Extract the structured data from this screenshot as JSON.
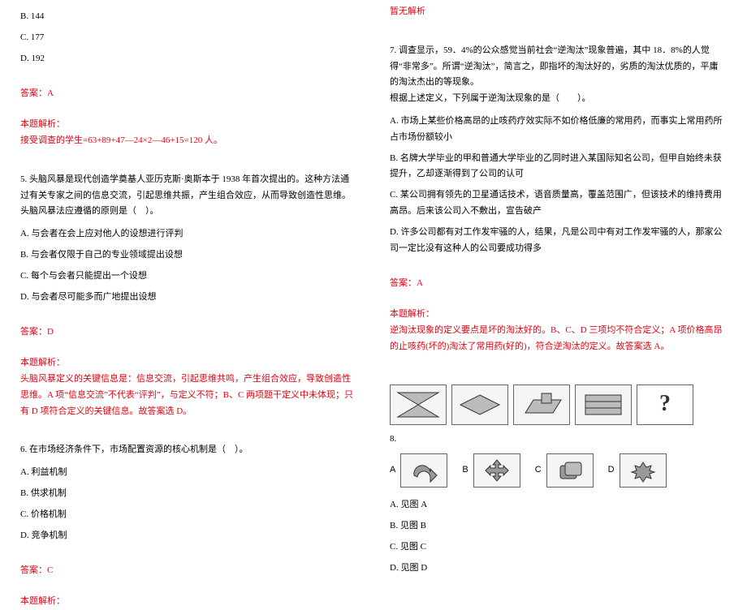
{
  "left": {
    "q4": {
      "optB": "B. 144",
      "optC": "C. 177",
      "optD": "D. 192",
      "ansLabel": "答案：A",
      "expLabel": "本题解析：",
      "expText": "接受调查的学生=63+89+47—24×2—46+15=120 人。"
    },
    "q5": {
      "stem": "5. 头脑风暴是现代创造学奠基人亚历克斯·奥斯本于 1938 年首次提出的。这种方法通过有关专家之间的信息交流，引起思维共振，产生组合效应，从而导致创造性思维。头脑风暴法应遵循的原则是（　）。",
      "optA": "A. 与会者在会上应对他人的设想进行评判",
      "optB": "B. 与会者仅限于自己的专业领域提出设想",
      "optC": "C. 每个与会者只能提出一个设想",
      "optD": "D. 与会者尽可能多而广地提出设想",
      "ansLabel": "答案：D",
      "expLabel": "本题解析：",
      "expText": "头脑风暴定义的关键信息是：信息交流，引起思维共鸣，产生组合效应，导致创造性思维。A 项“信息交流”不代表“评判”，与定义不符；B、C 两项题干定义中未体现；只有 D 项符合定义的关键信息。故答案选 D。"
    },
    "q6": {
      "stem": "6. 在市场经济条件下，市场配置资源的核心机制是（　）。",
      "optA": "A. 利益机制",
      "optB": "B. 供求机制",
      "optC": "C. 价格机制",
      "optD": "D. 竞争机制",
      "ansLabel": "答案：C",
      "expLabel": "本题解析："
    }
  },
  "right": {
    "noExp": "暂无解析",
    "q7": {
      "stem": "7. 调查显示，59．4%的公众感觉当前社会“逆淘汰”现象普遍，其中 18．8%的人觉得“非常多”。所谓“逆淘汰”，简言之，即指坏的淘汰好的，劣质的淘汰优质的，平庸的淘汰杰出的等现象。\n根据上述定义，下列属于逆淘汰现象的是（　　）。",
      "optA": "A. 市场上某些价格高昂的止咳药疗效实际不如价格低廉的常用药，而事实上常用药所占市场份额较小",
      "optB": "B. 名牌大学毕业的甲和普通大学毕业的乙同时进入某国际知名公司，但甲自始终未获提升，乙却逐渐得到了公司的认可",
      "optC": "C. 某公司拥有领先的卫星通话技术，语音质量高，覆盖范围广，但该技术的维持费用高昂。后来该公司入不敷出，宣告破产",
      "optD": "D. 许多公司都有对工作发牢骚的人，结果，凡是公司中有对工作发牢骚的人，那家公司一定比没有这种人的公司要成功得多",
      "ansLabel": "答案：A",
      "expLabel": "本题解析：",
      "expText": "逆淘汰现象的定义要点是坏的淘汰好的。B、C、D 三项均不符合定义；A 项价格高昂的止咳药(坏的)淘汰了常用药(好的)，符合逆淘汰的定义。故答案选 A。"
    },
    "q8": {
      "num": "8.",
      "qmark": "?",
      "labA": "A",
      "labB": "B",
      "labC": "C",
      "labD": "D",
      "optA": "A. 见图 A",
      "optB": "B. 见图 B",
      "optC": "C. 见图 C",
      "optD": "D. 见图 D"
    }
  }
}
